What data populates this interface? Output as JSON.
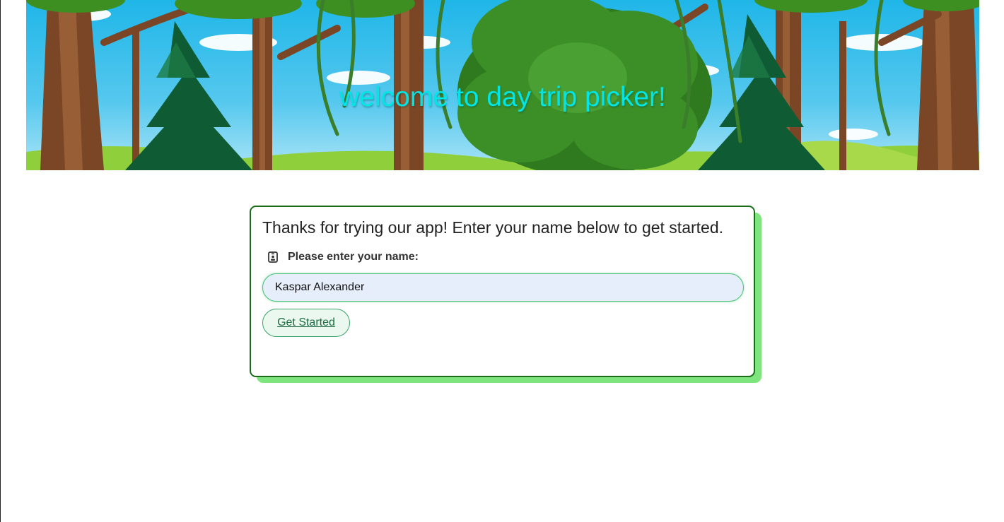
{
  "banner": {
    "title": "welcome to day trip picker!"
  },
  "card": {
    "intro": "Thanks for trying our app! Enter your name below to get started.",
    "name_label": "Please enter your name:",
    "name_value": "Kaspar Alexander",
    "name_icon": "id-badge-icon",
    "start_label": "Get Started"
  },
  "colors": {
    "title": "#00e5e5",
    "card_border": "#1a6b1a",
    "card_shadow": "#7ee57e",
    "input_bg": "#e6eefc",
    "button_bg": "#eaf8ef",
    "button_text": "#1d6b3e"
  }
}
